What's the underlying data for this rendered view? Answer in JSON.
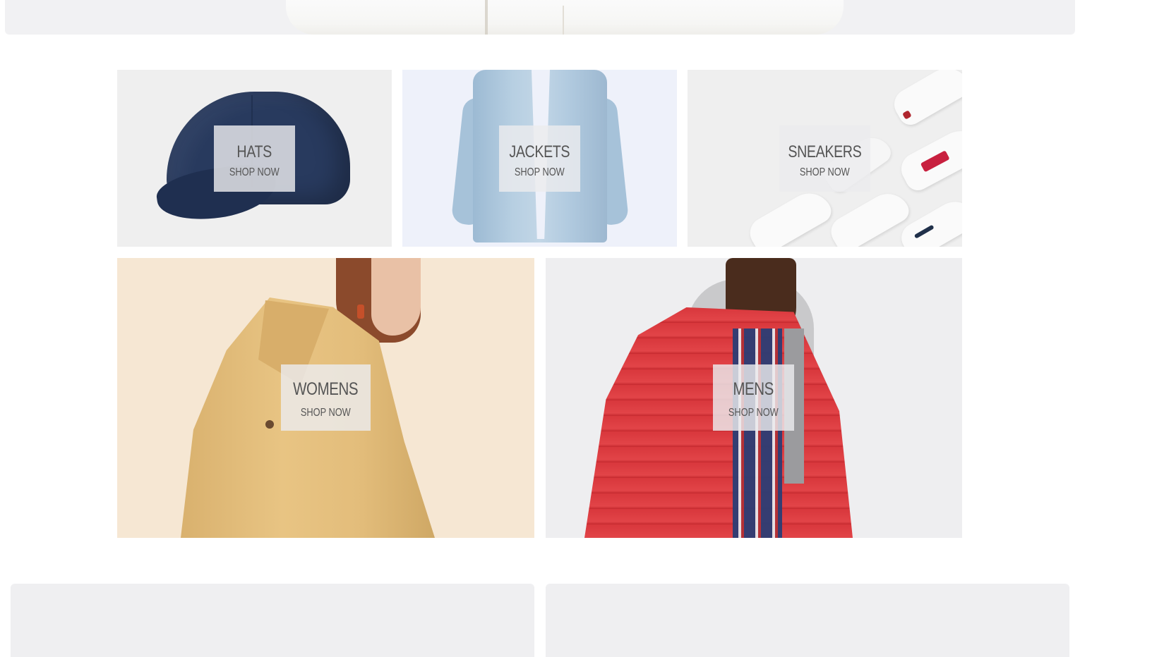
{
  "categories": {
    "hats": {
      "title": "HATS",
      "cta": "SHOP NOW"
    },
    "jackets": {
      "title": "JACKETS",
      "cta": "SHOP NOW"
    },
    "sneakers": {
      "title": "SNEAKERS",
      "cta": "SHOP NOW"
    },
    "womens": {
      "title": "WOMENS",
      "cta": "SHOP NOW"
    },
    "mens": {
      "title": "MENS",
      "cta": "SHOP NOW"
    }
  },
  "colors": {
    "label_overlay": "#ececee",
    "text": "#555555",
    "page_bg": "#ffffff",
    "panel_bg": "#f1f1f3"
  }
}
